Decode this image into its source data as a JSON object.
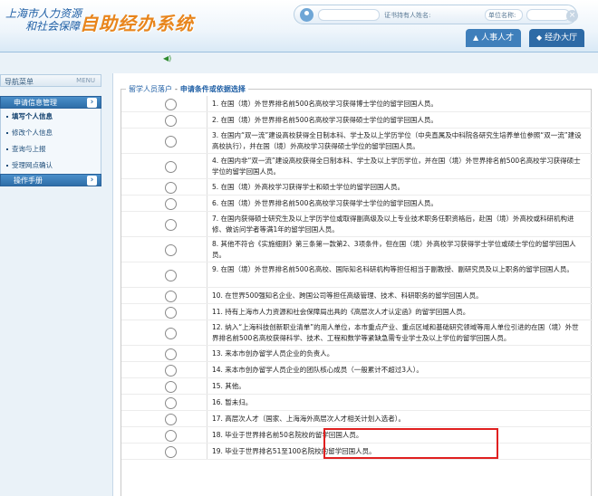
{
  "header": {
    "logo_line1": "上海市人力资源",
    "logo_line2": "和社会保障",
    "system_name": "自助经办系统",
    "card_holder_label": "证书持有人姓名:",
    "unit_name_label": "单位名称:",
    "close_glyph": "×",
    "tabs": [
      {
        "label": "人事人才",
        "icon": "▲"
      },
      {
        "label": "经办大厅",
        "icon": "◆"
      }
    ],
    "speaker_glyph": "◀)"
  },
  "sidebar": {
    "title": "导航菜单",
    "title_right": "MENU",
    "sections": [
      {
        "label": "申请信息管理",
        "chevron": "›",
        "items": [
          "填写个人信息",
          "修改个人信息",
          "查询与上报",
          "受理网点确认"
        ]
      },
      {
        "label": "操作手册",
        "chevron": "›",
        "items": []
      }
    ]
  },
  "main": {
    "legend_part1": "留学人员落户",
    "legend_sep": "-",
    "legend_part2": "申请条件或依据选择",
    "options": [
      "1. 在国（境）外世界排名前500名高校学习获得博士学位的留学回国人员。",
      "2. 在国（境）外世界排名前500名高校学习获得硕士学位的留学回国人员。",
      "3. 在国内“双一流”建设高校获得全日制本科、学士及以上学历学位（中央直属及中科院各研究生培养单位参照“双一流”建设高校执行），并在国（境）外高校学习获得硕士学位的留学回国人员。",
      "4. 在国内非“双一流”建设高校获得全日制本科、学士及以上学历学位，并在国（境）外世界排名前500名高校学习获得硕士学位的留学回国人员。",
      "5. 在国（境）外高校学习获得学士和硕士学位的留学回国人员。",
      "6. 在国（境）外世界排名前500名高校学习获得学士学位的留学回国人员。",
      "7. 在国内获得硕士研究生及以上学历学位或取得副高级及以上专业技术职务任职资格后，赴国（境）外高校或科研机构进修、做访问学者等满1年的留学回国人员。",
      "8. 其他不符合《实施细则》第三条第一款第2、3项条件，但在国（境）外高校学习获得学士学位或硕士学位的留学回国人员。",
      "9. 在国（境）外世界排名前500名高校、国际知名科研机构等担任相当于副教授、副研究员及以上职务的留学回国人员。",
      "10. 在世界500强知名企业、跨国公司等担任高级管理、技术、科研职务的留学回国人员。",
      "11. 持有上海市人力资源和社会保障局出具的《高层次人才认定函》的留学回国人员。",
      "12. 纳入“上海科技创新职业清单”的用人单位，本市重点产业、重点区域和基础研究领域等用人单位引进的在国（境）外世界排名前500名高校获得科学、技术、工程和数学等紧缺急需专业学士及以上学位的留学回国人员。",
      "13. 来本市创办留学人员企业的负责人。",
      "14. 来本市创办留学人员企业的团队核心成员（一般累计不超过3人）。",
      "15. 其他。",
      "16. 暂未归。",
      "17. 高层次人才（国家、上海海外高层次人才相关计划入选者）。",
      "18. 毕业于世界排名前50名院校的留学回国人员。",
      "19. 毕业于世界排名51至100名院校的留学回国人员。"
    ]
  }
}
